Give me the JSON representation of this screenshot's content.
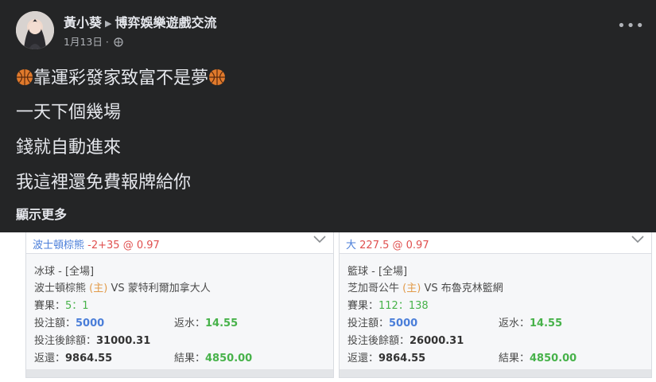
{
  "post": {
    "author": "黃小葵",
    "group": "博弈娛樂遊戲交流",
    "date": "1月13日",
    "more_icon": "more-dots-icon",
    "lines": [
      "靠運彩發家致富不是夢",
      "一天下個幾場",
      "錢就自動進來",
      "我這裡還免費報牌給你"
    ],
    "see_more": "顯示更多"
  },
  "cards": [
    {
      "pick_team": "波士頓棕熊",
      "pick_line": "-2+35",
      "pick_odds": "@ 0.97",
      "sport": "冰球 - [全場]",
      "home_team": "波士頓棕熊",
      "home_tag": "(主)",
      "vs": "VS",
      "away_team": "蒙特利爾加拿大人",
      "result_label": "賽果：",
      "result_value": "5：1",
      "stake_label": "投注額：",
      "stake_value": "5000",
      "rebate_label": "返水：",
      "rebate_value": "14.55",
      "balance_label": "投注後餘額：",
      "balance_value": "31000.31",
      "return_label": "返還：",
      "return_value": "9864.55",
      "outcome_label": "結果：",
      "outcome_value": "4850.00"
    },
    {
      "pick_team": "大",
      "pick_line": "227.5",
      "pick_odds": "@ 0.97",
      "sport": "籃球 - [全場]",
      "home_team": "芝加哥公牛",
      "home_tag": "(主)",
      "vs": "VS",
      "away_team": "布魯克林籃網",
      "result_label": "賽果：",
      "result_value": "112：138",
      "stake_label": "投注額：",
      "stake_value": "5000",
      "rebate_label": "返水：",
      "rebate_value": "14.55",
      "balance_label": "投注後餘額：",
      "balance_value": "26000.31",
      "return_label": "返還：",
      "return_value": "9864.55",
      "outcome_label": "結果：",
      "outcome_value": "4850.00"
    }
  ],
  "colors": {
    "post_bg": "#242526",
    "pick_blue": "#4a7ed9",
    "odds_red": "#e0504f",
    "value_green": "#47b24a",
    "home_tag_orange": "#e29b4a"
  }
}
